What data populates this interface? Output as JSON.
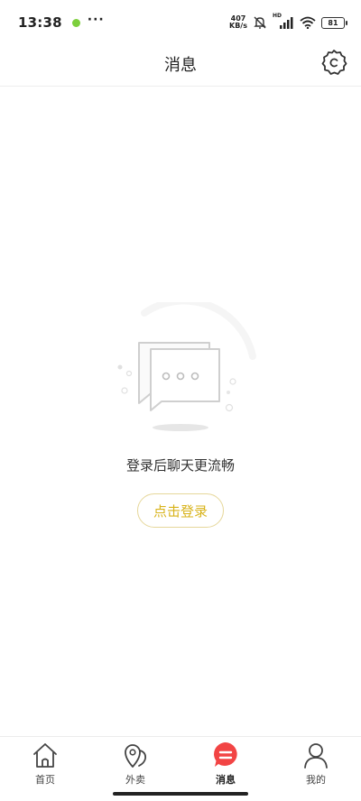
{
  "status_bar": {
    "time": "13:38",
    "more": "···",
    "speed_value": "407",
    "speed_unit": "KB/s",
    "hd": "HD",
    "battery": "81"
  },
  "header": {
    "title": "消息"
  },
  "empty_state": {
    "message": "登录后聊天更流畅",
    "login_label": "点击登录"
  },
  "tabs": [
    {
      "label": "首页",
      "icon": "home-icon"
    },
    {
      "label": "外卖",
      "icon": "location-pin-icon"
    },
    {
      "label": "消息",
      "icon": "message-icon",
      "active": true
    },
    {
      "label": "我的",
      "icon": "person-icon"
    }
  ],
  "colors": {
    "accent": "#d8b31a",
    "active_tab": "#f24444"
  }
}
